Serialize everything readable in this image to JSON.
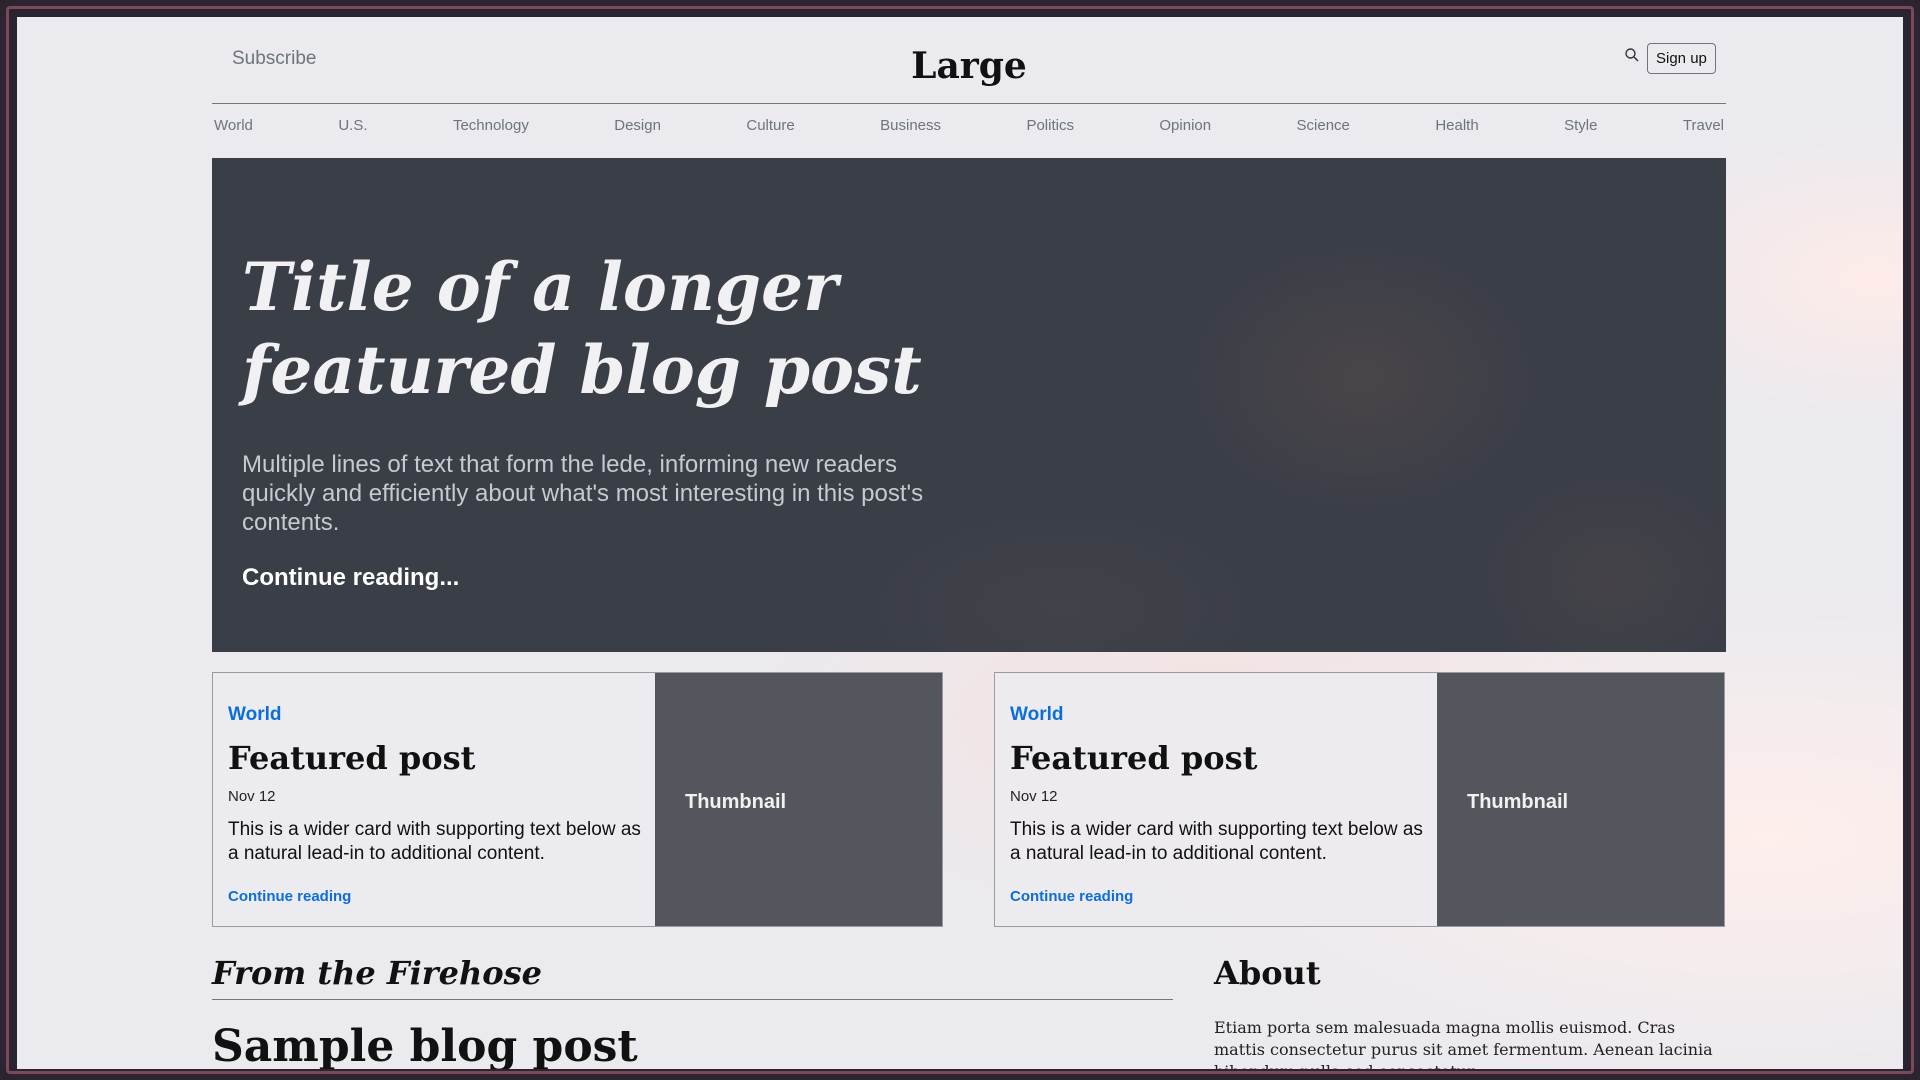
{
  "header": {
    "subscribe_label": "Subscribe",
    "brand": "Large",
    "signup_label": "Sign up"
  },
  "nav": {
    "items": [
      "World",
      "U.S.",
      "Technology",
      "Design",
      "Culture",
      "Business",
      "Politics",
      "Opinion",
      "Science",
      "Health",
      "Style",
      "Travel"
    ]
  },
  "hero": {
    "title": "Title of a longer featured blog post",
    "lede": "Multiple lines of text that form the lede, informing new readers quickly and efficiently about what's most interesting in this post's contents.",
    "link": "Continue reading..."
  },
  "cards": [
    {
      "category": "World",
      "title": "Featured post",
      "date": "Nov 12",
      "text": "This is a wider card with supporting text below as a natural lead-in to additional content.",
      "link": "Continue reading",
      "thumbnail": "Thumbnail"
    },
    {
      "category": "World",
      "title": "Featured post",
      "date": "Nov 12",
      "text": "This is a wider card with supporting text below as a natural lead-in to additional content.",
      "link": "Continue reading",
      "thumbnail": "Thumbnail"
    }
  ],
  "main": {
    "section_heading": "From the Firehose",
    "post_title": "Sample blog post"
  },
  "about": {
    "heading": "About",
    "text": "Etiam porta sem malesuada magna mollis euismod. Cras mattis consectetur purus sit amet fermentum. Aenean lacinia bibendum nulla sed consectetur."
  },
  "colors": {
    "accent_link": "#0d6ed9",
    "hero_bg": "#3a3e47",
    "thumbnail_bg": "#53565c"
  },
  "icons": [
    "search-icon"
  ]
}
